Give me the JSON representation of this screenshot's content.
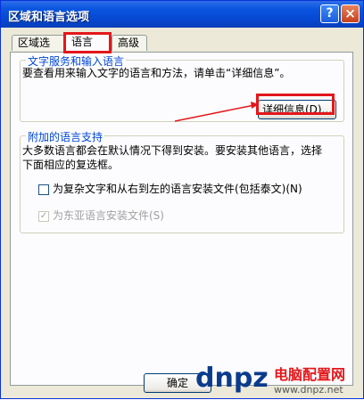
{
  "window": {
    "title": "区域和语言选项",
    "help_button": "?",
    "close_button": "×"
  },
  "tabs": [
    {
      "label": "区域选项"
    },
    {
      "label": "语言",
      "selected": true
    },
    {
      "label": "高级"
    }
  ],
  "text_services": {
    "group_title": "文字服务和输入语言",
    "description": "要查看用来输入文字的语言和方法，请单击“详细信息”。",
    "details_button": "详细信息(D)..."
  },
  "supplemental": {
    "group_title": "附加的语言支持",
    "description_line1": "大多数语言都会在默认情况下得到安装。要安装其他语言，选择",
    "description_line2": "下面相应的复选框。",
    "complex_scripts_label": "为复杂文字和从右到左的语言安装文件(包括泰文)(N)",
    "complex_scripts_checked": false,
    "east_asian_label": "为东亚语言安装文件(S)",
    "east_asian_checked": true,
    "east_asian_enabled": false
  },
  "footer": {
    "ok_button": "确定"
  },
  "watermark": {
    "logo": "dnpz",
    "site_name": "电脑配置网",
    "url": "www.dnpz.net"
  },
  "colors": {
    "title_bar": "#0a55e0",
    "annotation_red": "#e3171b",
    "group_title": "#0046d5",
    "dialog_bg": "#ece9d8"
  }
}
